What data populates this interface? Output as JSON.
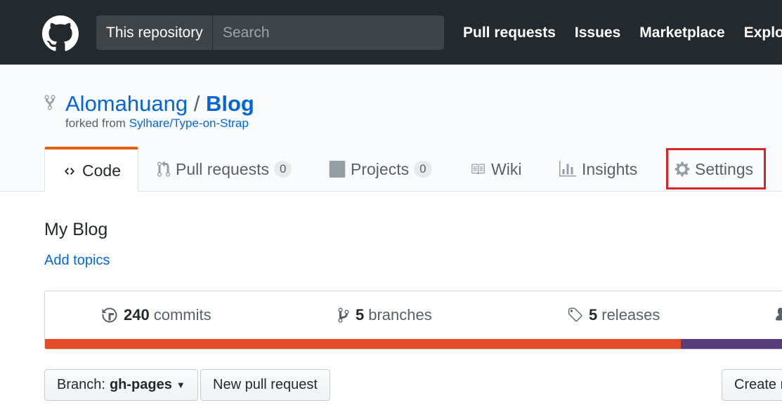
{
  "header": {
    "search_scope": "This repository",
    "search_placeholder": "Search",
    "nav": [
      "Pull requests",
      "Issues",
      "Marketplace",
      "Explo"
    ]
  },
  "repo": {
    "owner": "Alomahuang",
    "separator": "/",
    "name": "Blog",
    "forked_prefix": "forked from",
    "forked_source": "Sylhare/Type-on-Strap"
  },
  "tabs": {
    "code": "Code",
    "pulls": "Pull requests",
    "pulls_count": "0",
    "projects": "Projects",
    "projects_count": "0",
    "wiki": "Wiki",
    "insights": "Insights",
    "settings": "Settings"
  },
  "main": {
    "description": "My Blog",
    "add_topics": "Add topics"
  },
  "summary": {
    "commits_count": "240",
    "commits_label": "commits",
    "branches_count": "5",
    "branches_label": "branches",
    "releases_count": "5",
    "releases_label": "releases"
  },
  "language_bar": [
    {
      "color": "#e34c26",
      "share": 0.855
    },
    {
      "color": "#563d7c",
      "share": 0.145
    }
  ],
  "buttons": {
    "branch_prefix": "Branch:",
    "branch_name": "gh-pages",
    "new_pull_request": "New pull request",
    "create": "Create n"
  },
  "colors": {
    "header_bg": "#24292e",
    "link": "#0366d6",
    "tab_accent": "#e36209",
    "highlight_box": "#d9232e"
  }
}
